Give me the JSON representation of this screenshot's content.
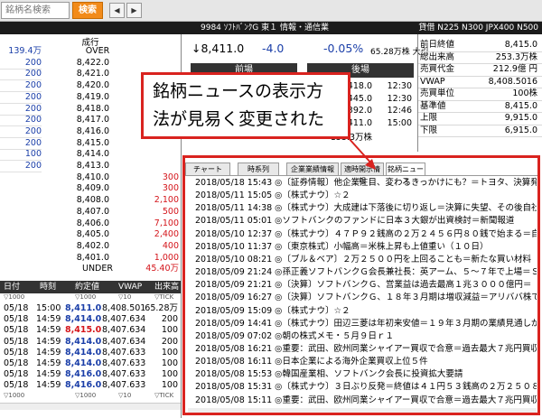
{
  "toolbar": {
    "search_placeholder": "銘柄名検索",
    "search_label": "検索",
    "nav_left": "◀",
    "nav_right": "▶"
  },
  "header": {
    "stock": "9984 ｿﾌﾄﾊﾞﾝｸG 東１ 情報・通信業",
    "index": "貸借 N225 N300 JPX400 N500"
  },
  "board": {
    "col_title": "成行",
    "rows": [
      {
        "l": "139.4万",
        "m": "OVER",
        "r": "",
        "cen": true
      },
      {
        "l": "200",
        "m": "8,422.0",
        "r": ""
      },
      {
        "l": "200",
        "m": "8,421.0",
        "r": ""
      },
      {
        "l": "200",
        "m": "8,420.0",
        "r": ""
      },
      {
        "l": "200",
        "m": "8,419.0",
        "r": ""
      },
      {
        "l": "200",
        "m": "8,418.0",
        "r": ""
      },
      {
        "l": "200",
        "m": "8,417.0",
        "r": ""
      },
      {
        "l": "200",
        "m": "8,416.0",
        "r": ""
      },
      {
        "l": "200",
        "m": "8,415.0",
        "r": ""
      },
      {
        "l": "100",
        "m": "8,414.0",
        "r": ""
      },
      {
        "l": "200",
        "m": "8,413.0",
        "r": ""
      },
      {
        "l": "",
        "m": "8,410.0",
        "r": "300"
      },
      {
        "l": "",
        "m": "8,409.0",
        "r": "300"
      },
      {
        "l": "",
        "m": "8,408.0",
        "r": "2,100"
      },
      {
        "l": "",
        "m": "8,407.0",
        "r": "500"
      },
      {
        "l": "",
        "m": "8,406.0",
        "r": "7,100"
      },
      {
        "l": "",
        "m": "8,405.0",
        "r": "2,400"
      },
      {
        "l": "",
        "m": "8,402.0",
        "r": "400"
      },
      {
        "l": "",
        "m": "8,401.0",
        "r": "1,000"
      },
      {
        "l": "",
        "m": "UNDER",
        "r": "45.40万",
        "cen": true
      }
    ]
  },
  "quote": {
    "price": "↓8,411.0",
    "change": "-4.0",
    "pct": "-0.05%",
    "volume": "65.28万株 大引",
    "morning": "前場",
    "afternoon": "後場",
    "sessions": [
      {
        "p": "8,418.0",
        "t": "12:30"
      },
      {
        "p": "8,445.0",
        "t": "12:30"
      },
      {
        "p": "8,392.0",
        "t": "12:46"
      },
      {
        "p": "8,411.0",
        "t": "15:00"
      },
      {
        "p": "153.3万株",
        "t": ""
      }
    ]
  },
  "stats": [
    {
      "k": "前日終値",
      "v": "8,415.0"
    },
    {
      "k": "総出来高",
      "v": "253.3万株"
    },
    {
      "k": "売買代金",
      "v": "212.9億 円"
    },
    {
      "k": "VWAP",
      "v": "8,408.5016"
    },
    {
      "k": "売買単位",
      "v": "100株"
    },
    {
      "k": "基準値",
      "v": "8,415.0"
    },
    {
      "k": "上限",
      "v": "9,915.0"
    },
    {
      "k": "下限",
      "v": "6,915.0"
    }
  ],
  "callout": {
    "line1": "銘柄ニュースの表示方",
    "line2": "法が見易く変更された"
  },
  "tabs": [
    "チャート",
    "時系列",
    "企業業績情報",
    "適時開示情報",
    "銘柄ニュース"
  ],
  "news": [
    "2018/05/18 15:43 ◎〔証券情報〕他企業注目、変わるきっかけにも？＝トヨタ、決算発",
    "2018/05/11 15:05 ◎〔株式ナウ〕☆２",
    "2018/05/11 14:38 ◎〔株式ナウ〕大成建は下落後に切り返し＝決算に失望、その後自社",
    "2018/05/11 05:01 ◎ソフトバンクのファンドに日本３大銀が出資検討＝新聞報道",
    "2018/05/10 12:37 ◎〔株式ナウ〕４７Ｐ９２銭高の２万２４５６円８０銭で始まる＝自",
    "2018/05/10 11:37 ◎〔東京株式〕小幅高＝米株上昇も上値重い（１０日）",
    "2018/05/10 08:21 ◎〔ブル＆ベア〕２万２５００円を上回ることも＝新たな買い材料",
    "2018/05/09 21:24 ◎孫正義ソフトバンクＧ会長兼社長：英アーム、５～７年で上場＝ＳＢ",
    "2018/05/09 21:21 ◎〔決算〕ソフトバンクＧ、営業益は過去最高１兆３０００億円＝",
    "2018/05/09 16:27 ◎〔決算〕ソフトバンクＧ、１８年３月期は増収減益＝アリババ株で",
    "2018/05/09 15:09 ◎〔株式ナウ〕☆２",
    "2018/05/09 14:41 ◎〔株式ナウ〕田辺三菱は年初来安値＝１９年３月期の業績見通しが",
    "2018/05/09 07:02 ◎朝の株式メモ・５月９日ｒ１",
    "2018/05/08 16:21 ◎重要：武田、欧州同業シャイアー買収で合意＝過去最大７兆円買収",
    "2018/05/08 16:11 ◎日本企業による海外企業買収上位５件",
    "2018/05/08 15:53 ◎韓国産業相、ソフトバンク会長に投資拡大要請",
    "2018/05/08 15:31 ◎〔株式ナウ〕３日ぶり反発＝終値は４１円５３銭高の２万２５０８",
    "2018/05/08 15:11 ◎重要：武田、欧州同業シャイアー買収で合意＝過去最大７兆円買収"
  ],
  "trades": {
    "headers": [
      "日付",
      "時刻",
      "約定値",
      "VWAP",
      "出来高"
    ],
    "sub": [
      "▽1000",
      "",
      "▽1000",
      "▽10",
      "▽TICK"
    ],
    "rows": [
      {
        "d": "05/18",
        "t": "15:00",
        "p": "8,411.0",
        "c": "blue",
        "v": "8,408.501",
        "q": "65.28万"
      },
      {
        "d": "05/18",
        "t": "14:59",
        "p": "8,414.0",
        "c": "blue",
        "v": "8,407.634",
        "q": "200"
      },
      {
        "d": "05/18",
        "t": "14:59",
        "p": "8,415.0",
        "c": "red",
        "v": "8,407.634",
        "q": "100"
      },
      {
        "d": "05/18",
        "t": "14:59",
        "p": "8,414.0",
        "c": "blue",
        "v": "8,407.634",
        "q": "200"
      },
      {
        "d": "05/18",
        "t": "14:59",
        "p": "8,414.0",
        "c": "blue",
        "v": "8,407.633",
        "q": "100"
      },
      {
        "d": "05/18",
        "t": "14:59",
        "p": "8,414.0",
        "c": "blue",
        "v": "8,407.633",
        "q": "100"
      },
      {
        "d": "05/18",
        "t": "14:59",
        "p": "8,416.0",
        "c": "blue",
        "v": "8,407.633",
        "q": "100"
      },
      {
        "d": "05/18",
        "t": "14:59",
        "p": "8,416.0",
        "c": "blue",
        "v": "8,407.633",
        "q": "100"
      }
    ]
  },
  "colors": {
    "accent": "#f28b1a",
    "callout": "#d9231f",
    "blue": "#1a3ea8",
    "red": "#d4141a"
  }
}
